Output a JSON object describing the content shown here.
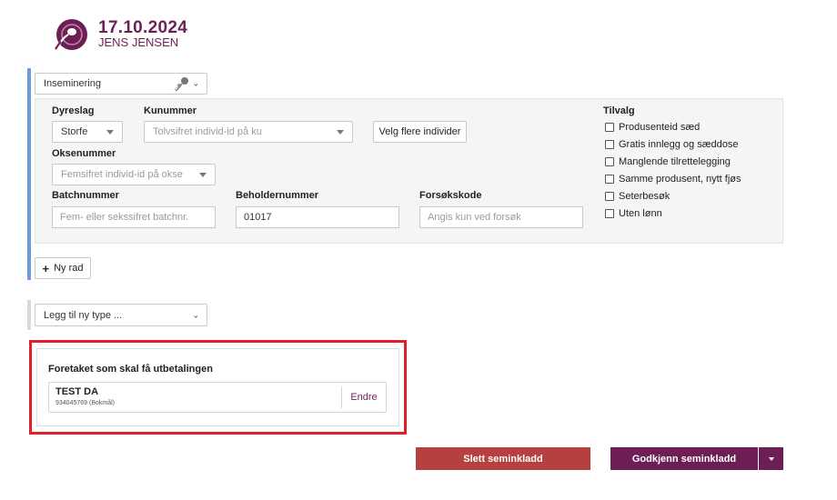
{
  "header": {
    "date": "17.10.2024",
    "name": "JENS JENSEN"
  },
  "colors": {
    "brand": "#6d1f55",
    "delete": "#b5403f",
    "highlight": "#e01f26",
    "accent_bar": "#6f9bd8"
  },
  "type_select": {
    "value": "Inseminering",
    "icon": "sperm-icon"
  },
  "form": {
    "dyreslag_label": "Dyreslag",
    "dyreslag_value": "Storfe",
    "kunummer_label": "Kunummer",
    "kunummer_placeholder": "Tolvsifret individ-id på ku",
    "velg_button": "Velg flere individer",
    "oksenummer_label": "Oksenummer",
    "oksenummer_placeholder": "Femsifret individ-id på okse",
    "batch_label": "Batchnummer",
    "batch_placeholder": "Fem- eller sekssifret batchnr.",
    "beholder_label": "Beholdernummer",
    "beholder_value": "01017",
    "forsok_label": "Forsøkskode",
    "forsok_placeholder": "Angis kun ved forsøk"
  },
  "tilvalg": {
    "title": "Tilvalg",
    "options": [
      "Produsenteid sæd",
      "Gratis innlegg og sæddose",
      "Manglende tilrettelegging",
      "Samme produsent, nytt fjøs",
      "Seterbesøk",
      "Uten lønn"
    ]
  },
  "new_row": {
    "label": "Ny rad"
  },
  "add_type": {
    "value": "Legg til ny type ..."
  },
  "payment": {
    "title": "Foretaket som skal få utbetalingen",
    "company_name": "TEST DA",
    "company_org": "934045769 (Bokmål)",
    "edit": "Endre"
  },
  "actions": {
    "delete": "Slett seminkladd",
    "approve": "Godkjenn seminkladd"
  }
}
